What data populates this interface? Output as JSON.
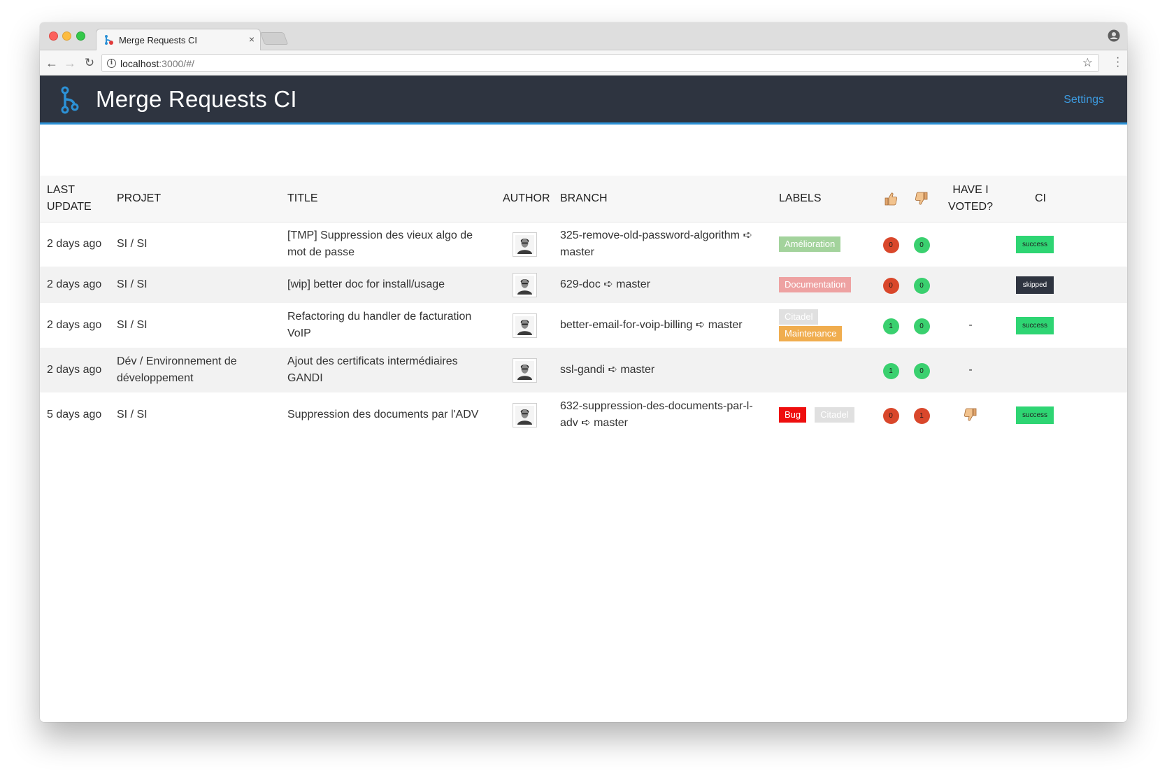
{
  "browser": {
    "tab_title": "Merge Requests CI",
    "tab_close": "×",
    "url_host": "localhost",
    "url_rest": ":3000/#/"
  },
  "app": {
    "title": "Merge Requests CI",
    "settings_label": "Settings"
  },
  "table": {
    "headers": {
      "last_update_1": "LAST",
      "last_update_2": "UPDATE",
      "project": "PROJET",
      "title": "TITLE",
      "author": "AUTHOR",
      "branch": "BRANCH",
      "labels": "LABELS",
      "voted_1": "HAVE I",
      "voted_2": "VOTED?",
      "ci": "CI"
    },
    "rows": [
      {
        "updated": "2 days ago",
        "project": "SI / SI",
        "title": "[TMP] Suppression des vieux algo de mot de passe",
        "branch": "325-remove-old-password-algorithm ➪ master",
        "labels": [
          {
            "text": "Amélioration",
            "color": "#a3d39c"
          }
        ],
        "up_votes": "0",
        "up_color": "#d9472b",
        "down_votes": "0",
        "down_color": "#3ad06f",
        "voted": "",
        "ci": "success",
        "ci_color": "#2ed573"
      },
      {
        "updated": "2 days ago",
        "project": "SI / SI",
        "title": "[wip] better doc for install/usage",
        "branch": "629-doc ➪ master",
        "labels": [
          {
            "text": "Documentation",
            "color": "#eea2a2"
          }
        ],
        "up_votes": "0",
        "up_color": "#d9472b",
        "down_votes": "0",
        "down_color": "#3ad06f",
        "voted": "",
        "ci": "skipped",
        "ci_color": "#2e3440"
      },
      {
        "updated": "2 days ago",
        "project": "SI / SI",
        "title": "Refactoring du handler de facturation VoIP",
        "branch": "better-email-for-voip-billing ➪ master",
        "labels": [
          {
            "text": "Citadel",
            "color": "#e0e0e0"
          },
          {
            "text": "Maintenance",
            "color": "#f0ad4e"
          }
        ],
        "up_votes": "1",
        "up_color": "#3ad06f",
        "down_votes": "0",
        "down_color": "#3ad06f",
        "voted": "-",
        "ci": "success",
        "ci_color": "#2ed573"
      },
      {
        "updated": "2 days ago",
        "project": "Dév / Environnement de développement",
        "title": "Ajout des certificats intermédiaires GANDI",
        "branch": "ssl-gandi ➪ master",
        "labels": [],
        "up_votes": "1",
        "up_color": "#3ad06f",
        "down_votes": "0",
        "down_color": "#3ad06f",
        "voted": "-",
        "ci": "",
        "ci_color": ""
      },
      {
        "updated": "5 days ago",
        "project": "SI / SI",
        "title": "Suppression des documents par l'ADV",
        "branch": "632-suppression-des-documents-par-l-adv ➪ master",
        "labels": [
          {
            "text": "Bug",
            "color": "#ee0e0e"
          },
          {
            "text": "Citadel",
            "color": "#e0e0e0"
          }
        ],
        "up_votes": "0",
        "up_color": "#d9472b",
        "down_votes": "1",
        "down_color": "#d9472b",
        "voted": "thumbs-down-icon",
        "ci": "success",
        "ci_color": "#2ed573"
      }
    ]
  }
}
